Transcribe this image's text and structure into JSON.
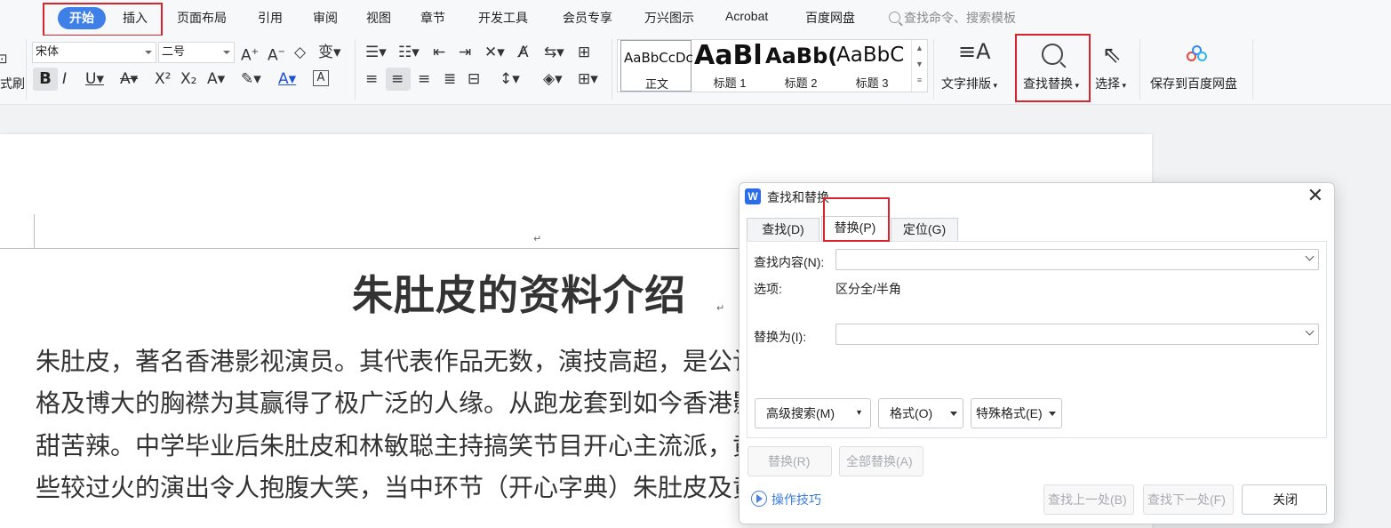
{
  "menu": {
    "tabs": [
      {
        "label": "开始",
        "active": true
      },
      {
        "label": "插入"
      },
      {
        "label": "页面布局"
      },
      {
        "label": "引用"
      },
      {
        "label": "审阅"
      },
      {
        "label": "视图"
      },
      {
        "label": "章节"
      },
      {
        "label": "开发工具"
      },
      {
        "label": "会员专享"
      },
      {
        "label": "万兴图示"
      },
      {
        "label": "Acrobat"
      },
      {
        "label": "百度网盘"
      }
    ],
    "search_placeholder": "查找命令、搜索模板"
  },
  "ribbon": {
    "format_painter_partial": "式刷",
    "font_name": "宋体",
    "font_size": "二号",
    "styles": [
      {
        "sample": "AaBbCcDc",
        "label": "正文"
      },
      {
        "sample": "AaBl",
        "label": "标题 1"
      },
      {
        "sample": "AaBb(",
        "label": "标题 2"
      },
      {
        "sample": "AaBbC",
        "label": "标题 3"
      }
    ],
    "text_layout_label": "文字排版",
    "find_replace_label": "查找替换",
    "select_label": "选择",
    "save_baidu_label": "保存到百度网盘"
  },
  "document": {
    "title": "朱肚皮的资料介绍",
    "lines": [
      "朱肚皮，著名香港影视演员。其代表作品无数，演技高超，是公认",
      "格及博大的胸襟为其赢得了极广泛的人缘。从跑龙套到如今香港影",
      "甜苦辣。中学毕业后朱肚皮和林敏聪主持搞笑节目开心主流派，黄",
      "些较过火的演出令人抱腹大笑，当中环节（开心字典）朱肚皮及黄"
    ]
  },
  "dialog": {
    "title": "查找和替换",
    "tabs": [
      "查找(D)",
      "替换(P)",
      "定位(G)"
    ],
    "active_tab": "替换(P)",
    "find_label": "查找内容(N):",
    "find_value": "",
    "options_label": "选项:",
    "options_value": "区分全/半角",
    "replace_label": "替换为(I):",
    "replace_value": "",
    "advanced_search": "高级搜索(M)",
    "format": "格式(O)",
    "special_format": "特殊格式(E)",
    "replace": "替换(R)",
    "replace_all": "全部替换(A)",
    "tips": "操作技巧",
    "find_prev": "查找上一处(B)",
    "find_next": "查找下一处(F)",
    "close": "关闭"
  }
}
